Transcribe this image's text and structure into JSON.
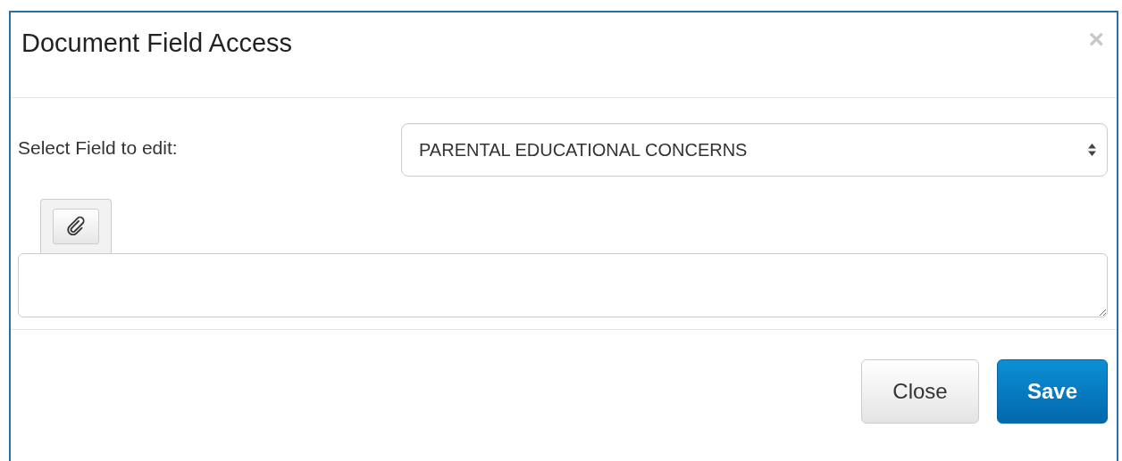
{
  "dialog": {
    "title": "Document Field Access",
    "close_glyph": "×"
  },
  "field_select": {
    "label": "Select Field to edit:",
    "value": "PARENTAL EDUCATIONAL CONCERNS"
  },
  "buttons": [
    {
      "label": "Close",
      "kind": "default"
    },
    {
      "label": "Save",
      "kind": "primary"
    }
  ]
}
